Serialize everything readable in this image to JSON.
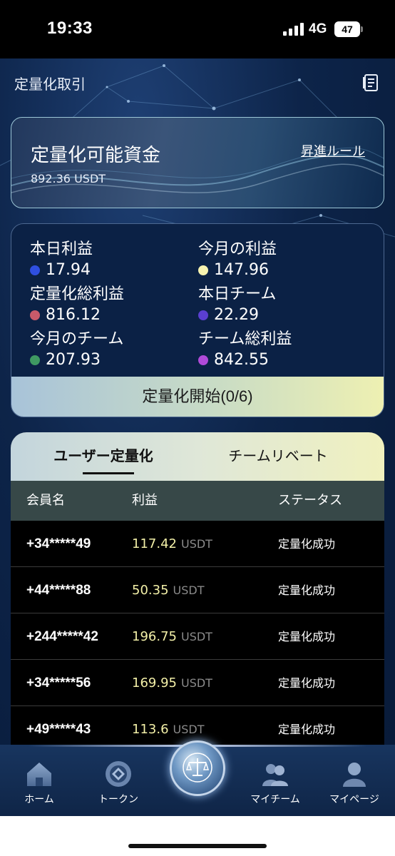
{
  "status_bar": {
    "time": "19:33",
    "network": "4G",
    "battery": "47"
  },
  "header": {
    "title": "定量化取引"
  },
  "fund_card": {
    "title": "定量化可能資金",
    "amount": "892.36 USDT",
    "link": "昇進ルール"
  },
  "stats": [
    {
      "label": "本日利益",
      "value": "17.94",
      "color": "#2f4fe0"
    },
    {
      "label": "今月の利益",
      "value": "147.96",
      "color": "#f7f3b0"
    },
    {
      "label": "定量化総利益",
      "value": "816.12",
      "color": "#c85a6a"
    },
    {
      "label": "本日チーム",
      "value": "22.29",
      "color": "#5a3fd0"
    },
    {
      "label": "今月のチーム",
      "value": "207.93",
      "color": "#3f9a62"
    },
    {
      "label": "チーム総利益",
      "value": "842.55",
      "color": "#b04ad8"
    }
  ],
  "start_button": "定量化開始(0/6)",
  "tabs": {
    "active": "ユーザー定量化",
    "other": "チームリベート"
  },
  "table": {
    "headers": {
      "member": "会員名",
      "profit": "利益",
      "status": "ステータス"
    },
    "unit": "USDT",
    "rows": [
      {
        "member": "+34*****49",
        "profit": "117.42",
        "status": "定量化成功"
      },
      {
        "member": "+44*****88",
        "profit": "50.35",
        "status": "定量化成功"
      },
      {
        "member": "+244*****42",
        "profit": "196.75",
        "status": "定量化成功"
      },
      {
        "member": "+34*****56",
        "profit": "169.95",
        "status": "定量化成功"
      },
      {
        "member": "+49*****43",
        "profit": "113.6",
        "status": "定量化成功"
      }
    ]
  },
  "nav": {
    "home": "ホーム",
    "token": "トークン",
    "team": "マイチーム",
    "mypage": "マイページ"
  },
  "icons": [
    "signal-icon",
    "document-icon",
    "home-icon",
    "token-icon",
    "balance-scale-icon",
    "team-icon",
    "user-icon"
  ]
}
